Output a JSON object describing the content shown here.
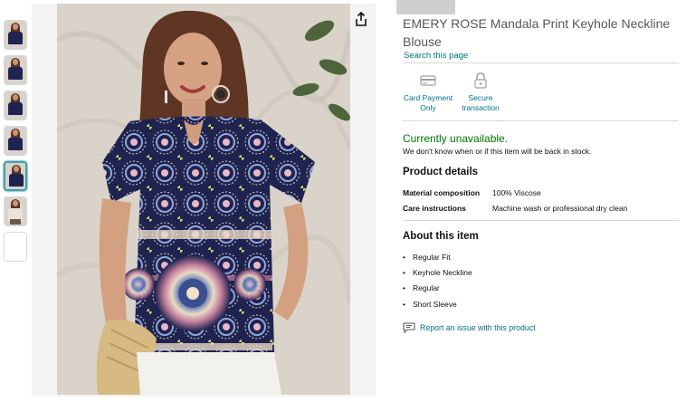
{
  "product": {
    "title": "EMERY ROSE Mandala Print Keyhole Neckline Blouse",
    "store_link": "Search this page"
  },
  "badges": [
    {
      "icon": "card-icon",
      "label": "Card Payment Only"
    },
    {
      "icon": "lock-icon",
      "label": "Secure transaction"
    }
  ],
  "availability": {
    "status": "Currently unavailable.",
    "note": "We don't know when or if this item will be back in stock."
  },
  "details": {
    "heading": "Product details",
    "rows": [
      {
        "key": "Material composition",
        "value": "100% Viscose"
      },
      {
        "key": "Care instructions",
        "value": "Machine wash or professional dry clean"
      }
    ]
  },
  "about": {
    "heading": "About this item",
    "bullets": [
      "Regular Fit",
      "Keyhole Neckline",
      "Regular",
      "Short Sleeve"
    ]
  },
  "report_link": "Report an issue with this product",
  "colors": {
    "link": "#007185",
    "available_green": "#007600",
    "active_thumb_border": "#3aa6a6",
    "blouse_navy": "#1f2350"
  }
}
